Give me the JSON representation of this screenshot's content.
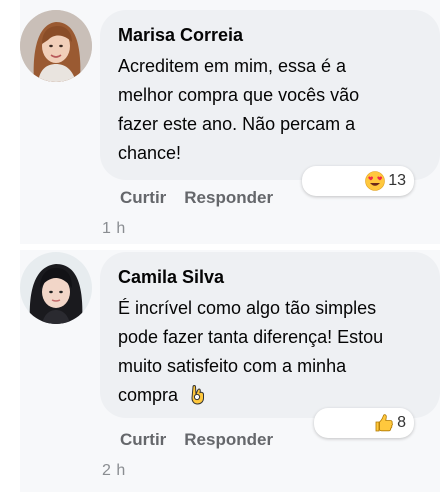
{
  "comments": [
    {
      "author": "Marisa Correia",
      "text": "Acreditem em mim, essa é a\nmelhor compra que vocês vão\nfazer este ano. Não percam a\nchance!",
      "reaction_icon": "heart-eyes-emoji-icon",
      "reaction_count": "13",
      "actions": {
        "like": "Curtir",
        "reply": "Responder"
      },
      "time": "1 h"
    },
    {
      "author": "Camila Silva",
      "text": "É incrível como algo tão simples\npode fazer tanta diferença! Estou\nmuito satisfeito com a minha\ncompra",
      "text_emoji": "ok-hand-emoji-icon",
      "reaction_icon": "thumbs-up-emoji-icon",
      "reaction_count": "8",
      "actions": {
        "like": "Curtir",
        "reply": "Responder"
      },
      "time": "2 h"
    }
  ],
  "colors": {
    "bubble": "#eef0f3",
    "background_strip": "#f7f8fa",
    "action_text": "#65676b",
    "time_text": "#8a8d91",
    "emoji_yellow": "#ffc83d",
    "heart_red": "#f0284a"
  }
}
